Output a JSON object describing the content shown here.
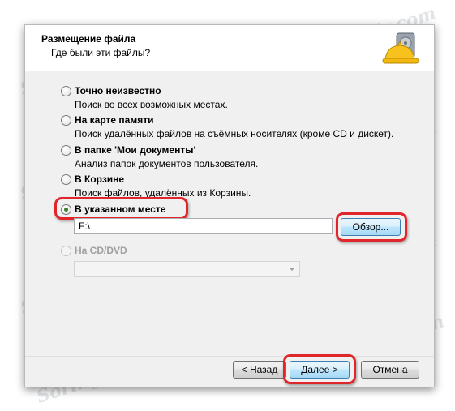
{
  "header": {
    "title": "Размещение файла",
    "subtitle": "Где были эти файлы?",
    "icon": "hard-hat-disk-icon"
  },
  "options": [
    {
      "label": "Точно неизвестно",
      "desc": "Поиск во всех возможных местах.",
      "checked": false,
      "disabled": false
    },
    {
      "label": "На карте памяти",
      "desc": "Поиск удалённых файлов на съёмных носителях (кроме CD и дискет).",
      "checked": false,
      "disabled": false
    },
    {
      "label": "В папке 'Мои документы'",
      "desc": "Анализ папок документов пользователя.",
      "checked": false,
      "disabled": false
    },
    {
      "label": "В Корзине",
      "desc": "Поиск файлов, удалённых из Корзины.",
      "checked": false,
      "disabled": false
    },
    {
      "label": "В указанном месте",
      "desc": "",
      "checked": true,
      "disabled": false
    },
    {
      "label": "На CD/DVD",
      "desc": "",
      "checked": false,
      "disabled": true
    }
  ],
  "path": {
    "value": "F:\\"
  },
  "browse_label": "Обзор...",
  "cd_select": {
    "value": ""
  },
  "footer": {
    "back_label": "< Назад",
    "next_label": "Далее >",
    "cancel_label": "Отмена"
  },
  "watermark": "Soringpcrepair.com",
  "colors": {
    "highlight": "#e0252b",
    "radio_dot": "#3a7d2a"
  }
}
